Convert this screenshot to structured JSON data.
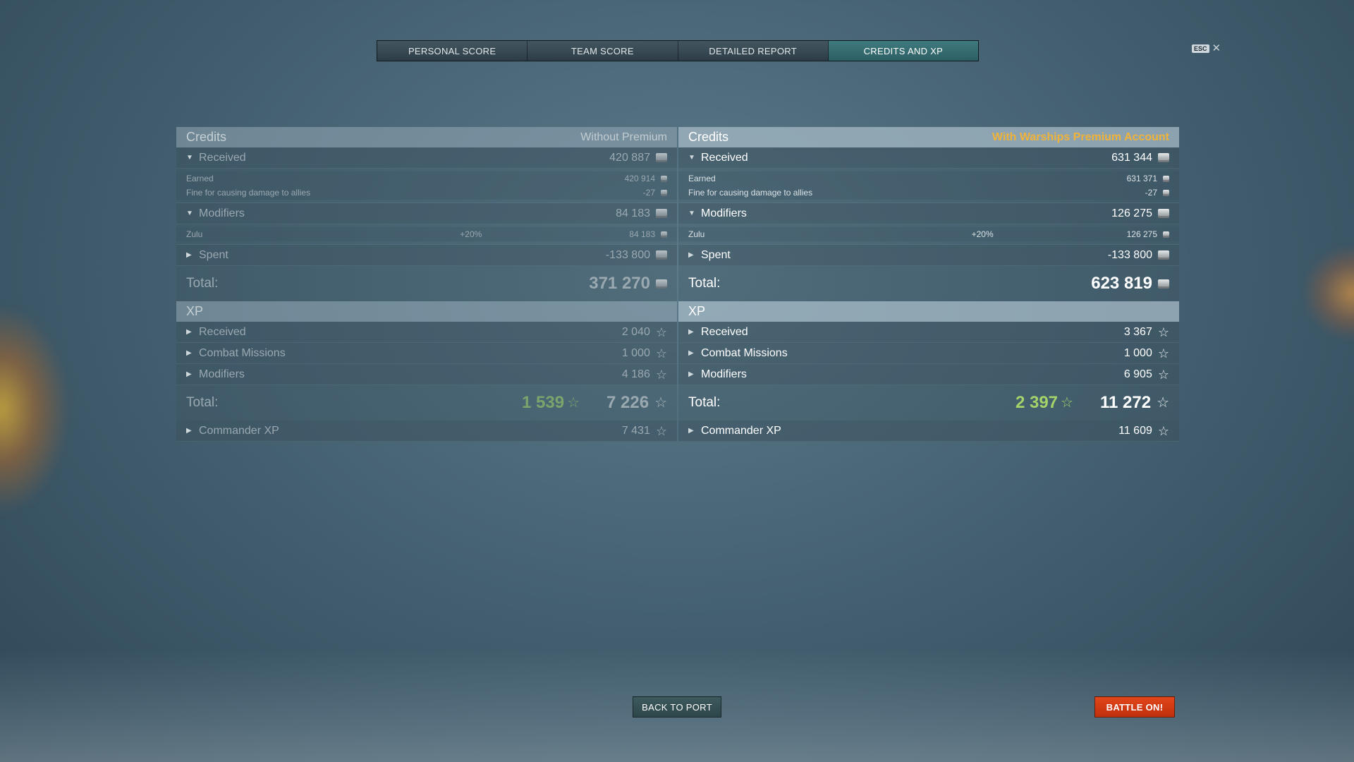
{
  "tabs": [
    {
      "label": "PERSONAL SCORE"
    },
    {
      "label": "TEAM SCORE"
    },
    {
      "label": "DETAILED REPORT"
    },
    {
      "label": "CREDITS AND XP",
      "active": true
    }
  ],
  "esc": {
    "key": "ESC",
    "close": "✕"
  },
  "left": {
    "credits_title": "Credits",
    "credits_note": "Without Premium",
    "received": {
      "label": "Received",
      "value": "420 887"
    },
    "earned": {
      "label": "Earned",
      "value": "420 914"
    },
    "fine": {
      "label": "Fine for causing damage to allies",
      "value": "-27"
    },
    "modifiers": {
      "label": "Modifiers",
      "value": "84 183"
    },
    "zulu": {
      "label": "Zulu",
      "pct": "+20%",
      "value": "84 183"
    },
    "spent": {
      "label": "Spent",
      "value": "-133 800"
    },
    "credits_total": {
      "label": "Total:",
      "value": "371 270"
    },
    "xp_title": "XP",
    "xp_received": {
      "label": "Received",
      "value": "2 040"
    },
    "xp_missions": {
      "label": "Combat Missions",
      "value": "1 000"
    },
    "xp_modifiers": {
      "label": "Modifiers",
      "value": "4 186"
    },
    "xp_total": {
      "label": "Total:",
      "free": "1 539",
      "value": "7 226"
    },
    "commander": {
      "label": "Commander XP",
      "value": "7 431"
    }
  },
  "right": {
    "credits_title": "Credits",
    "credits_note": "With Warships Premium Account",
    "received": {
      "label": "Received",
      "value": "631 344"
    },
    "earned": {
      "label": "Earned",
      "value": "631 371"
    },
    "fine": {
      "label": "Fine for causing damage to allies",
      "value": "-27"
    },
    "modifiers": {
      "label": "Modifiers",
      "value": "126 275"
    },
    "zulu": {
      "label": "Zulu",
      "pct": "+20%",
      "value": "126 275"
    },
    "spent": {
      "label": "Spent",
      "value": "-133 800"
    },
    "credits_total": {
      "label": "Total:",
      "value": "623 819"
    },
    "xp_title": "XP",
    "xp_received": {
      "label": "Received",
      "value": "3 367"
    },
    "xp_missions": {
      "label": "Combat Missions",
      "value": "1 000"
    },
    "xp_modifiers": {
      "label": "Modifiers",
      "value": "6 905"
    },
    "xp_total": {
      "label": "Total:",
      "free": "2 397",
      "value": "11 272"
    },
    "commander": {
      "label": "Commander XP",
      "value": "11 609"
    }
  },
  "buttons": {
    "back": "BACK TO PORT",
    "battle": "BATTLE ON!"
  },
  "colors": {
    "accent_tab": "#2c5f64",
    "premium_note": "#f0b33a",
    "free_xp": "#a5d36a",
    "battle_button": "#d23b14"
  },
  "icons": {
    "credit": "silver-coin-icon",
    "xp": "star-icon",
    "expand": "triangle-arrow-icon"
  }
}
